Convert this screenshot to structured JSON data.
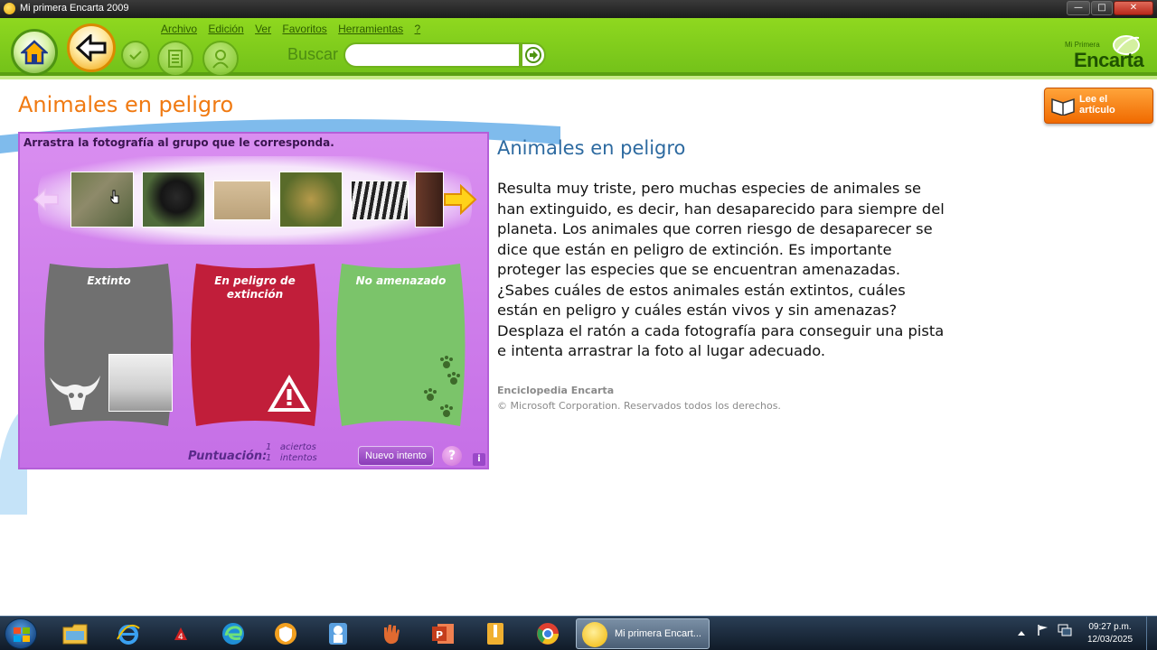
{
  "window": {
    "title": "Mi primera Encarta 2009",
    "controls": {
      "minimize": "—",
      "maximize": "□",
      "close": "✕"
    }
  },
  "menu": [
    "Archivo",
    "Edición",
    "Ver",
    "Favoritos",
    "Herramientas",
    "?"
  ],
  "search": {
    "label": "Buscar",
    "value": "",
    "placeholder": ""
  },
  "logo": {
    "small": "Mi Primera",
    "big": "Encarta"
  },
  "page_title": "Animales en peligro",
  "read_button": {
    "line1": "Lee el",
    "line2": "artículo"
  },
  "activity": {
    "instruction": "Arrastra la fotografía al grupo que le corresponda.",
    "photos": [
      "hippopotamus-photo",
      "gorilla-photo",
      "dry-animal-photo",
      "leopard-photo",
      "zebra-photo",
      "partial-photo"
    ],
    "groups": [
      {
        "label": "Extinto",
        "color": "#6f6f6f"
      },
      {
        "label": "En peligro de extinción",
        "color": "#c11e3a"
      },
      {
        "label": "No amenazado",
        "color": "#7bc46a"
      }
    ],
    "score": {
      "label": "Puntuación:",
      "hits_value": "1",
      "hits_label": "aciertos",
      "tries_value": "1",
      "tries_label": "intentos"
    },
    "retry_label": "Nuevo intento",
    "help_label": "?",
    "info_label": "i"
  },
  "article": {
    "title": "Animales en peligro",
    "body": "Resulta muy triste, pero muchas especies de animales se han extinguido, es decir, han desaparecido para siempre del planeta. Los animales que corren riesgo de desaparecer se dice que están en peligro de extinción. Es importante proteger las especies que se encuentran amenazadas. ¿Sabes cuáles de estos animales están extintos, cuáles están en peligro y cuáles están vivos y sin amenazas? Desplaza el ratón a cada fotografía para conseguir una pista e intenta arrastrar la foto al lugar adecuado.",
    "source": "Enciclopedia Encarta",
    "copyright": "© Microsoft Corporation. Reservados todos los derechos."
  },
  "taskbar": {
    "active_window": "Mi primera Encart...",
    "time": "09:27 p.m.",
    "date": "12/03/2025"
  },
  "colors": {
    "toolbar_green": "#8fd81f",
    "title_orange": "#f07a12",
    "article_blue": "#2d6aa0",
    "activity_purple": "#d98ef0"
  }
}
